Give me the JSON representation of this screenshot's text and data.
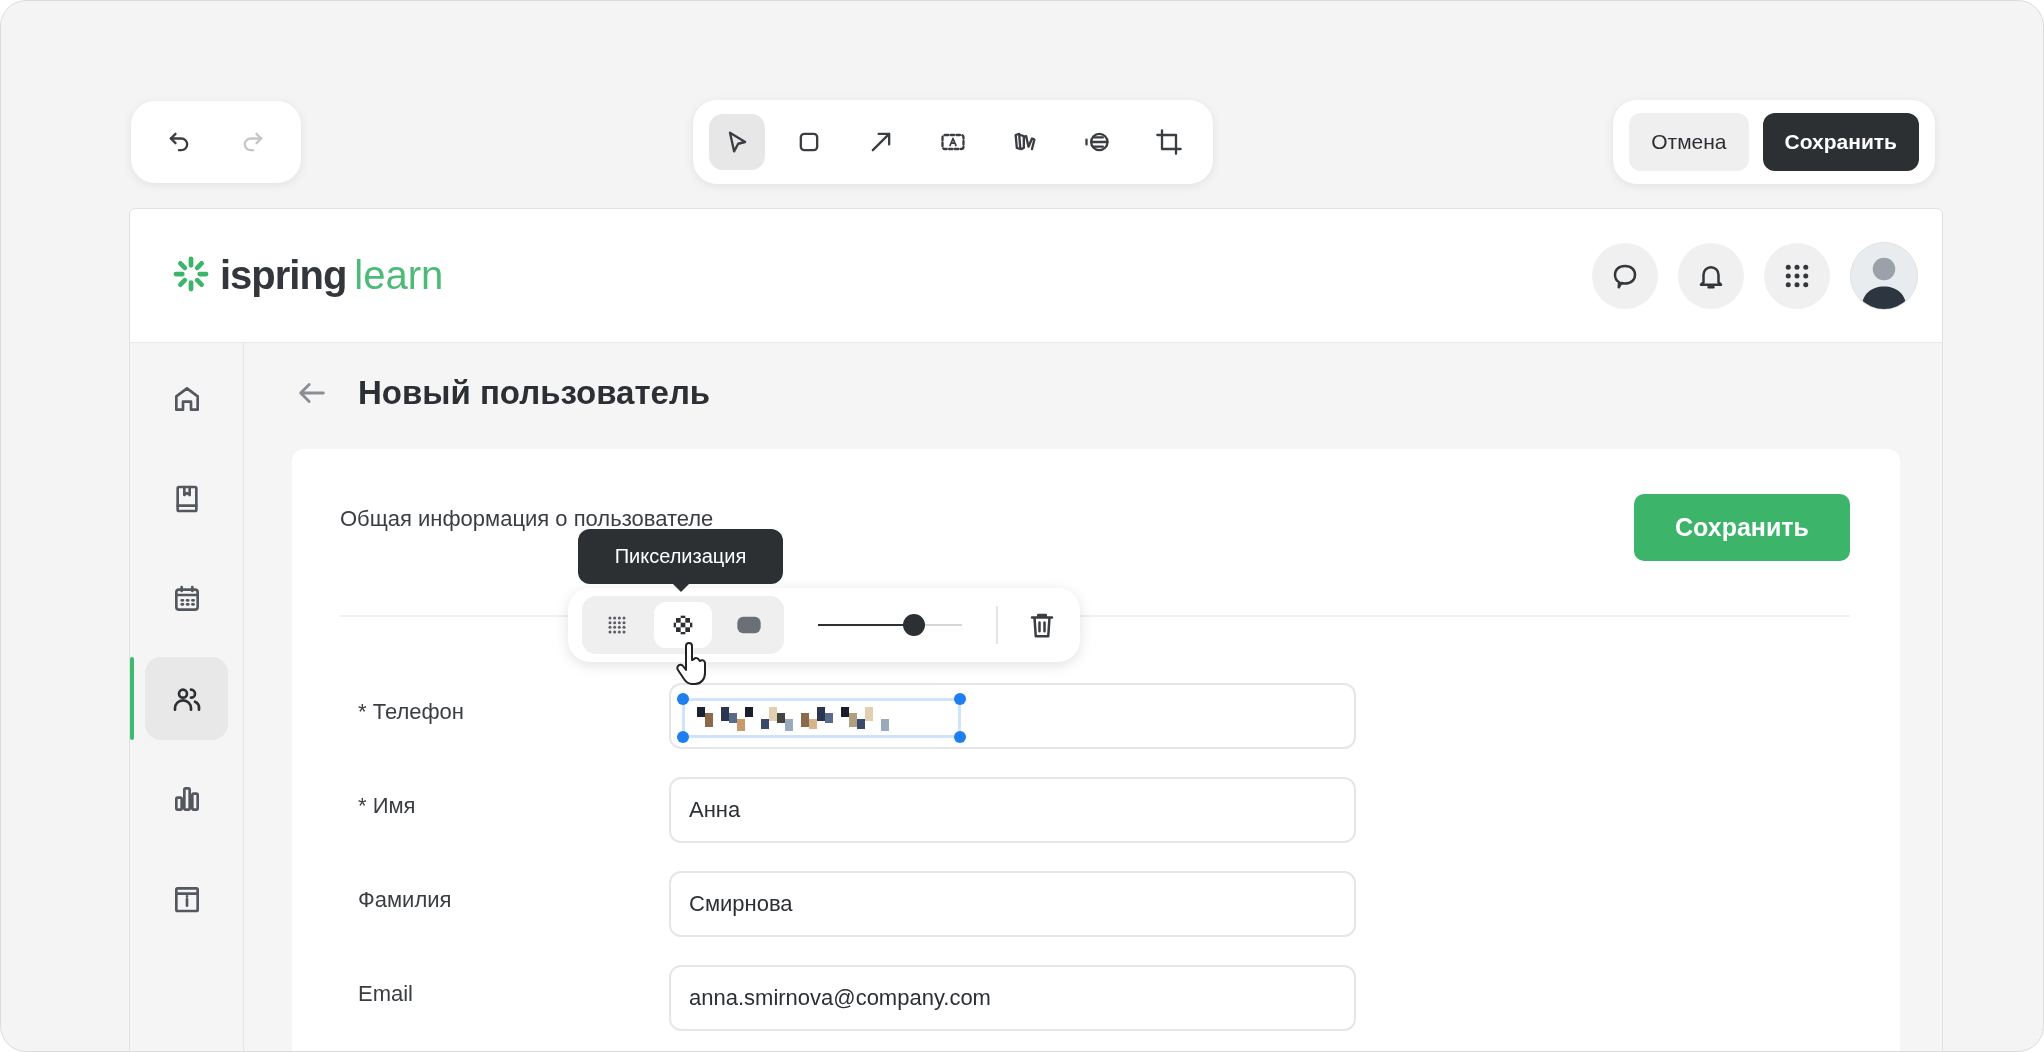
{
  "history": [
    {
      "kind": "undo",
      "disabled": false
    },
    {
      "kind": "redo",
      "disabled": true
    }
  ],
  "tools": [
    {
      "kind": "select",
      "selected": true
    },
    {
      "kind": "rectangle",
      "selected": false
    },
    {
      "kind": "arrow",
      "selected": false
    },
    {
      "kind": "text",
      "selected": false
    },
    {
      "kind": "marker",
      "selected": false
    },
    {
      "kind": "blur",
      "selected": false
    },
    {
      "kind": "crop",
      "selected": false
    }
  ],
  "actions": [
    {
      "label": "Отмена",
      "kind": "secondary"
    },
    {
      "label": "Сохранить",
      "kind": "primary"
    }
  ],
  "app": {
    "logo": {
      "brand": "ispring",
      "product": "learn"
    },
    "header_buttons": [
      {
        "kind": "chat"
      },
      {
        "kind": "bell"
      },
      {
        "kind": "apps"
      },
      {
        "kind": "avatar"
      }
    ],
    "sidebar": [
      {
        "kind": "home",
        "selected": false
      },
      {
        "kind": "book",
        "selected": false
      },
      {
        "kind": "calendar",
        "selected": false
      },
      {
        "kind": "users",
        "selected": true
      },
      {
        "kind": "chart",
        "selected": false
      },
      {
        "kind": "info",
        "selected": false
      }
    ],
    "page_title": "Новый пользователь",
    "section_title": "Общая информация о пользователе",
    "save_button": "Сохранить",
    "fields": [
      {
        "label": "* Телефон",
        "pixelated": true
      },
      {
        "label": "* Имя",
        "value": "Анна",
        "pixelated": false
      },
      {
        "label": "Фамилия",
        "value": "Смирнова",
        "pixelated": false
      },
      {
        "label": "Email",
        "value": "anna.smirnova@company.com",
        "pixelated": false
      }
    ]
  },
  "redact_toolbar": {
    "tooltip": "Пикселизация",
    "modes": [
      {
        "kind": "dots",
        "selected": false
      },
      {
        "kind": "pixelate",
        "selected": true
      },
      {
        "kind": "solid",
        "selected": false
      }
    ],
    "level": 0.67
  }
}
